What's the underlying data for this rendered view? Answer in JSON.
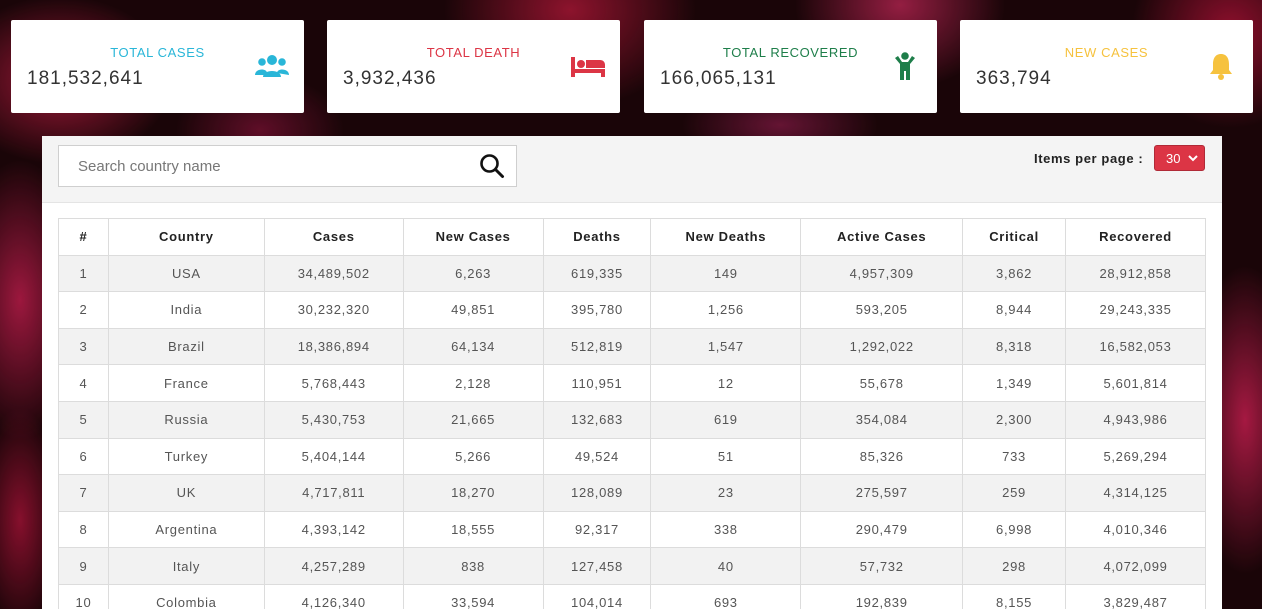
{
  "stats": [
    {
      "title": "TOTAL CASES",
      "value": "181,532,641",
      "color": "#29b6d8",
      "icon": "users-icon"
    },
    {
      "title": "TOTAL DEATH",
      "value": "3,932,436",
      "color": "#dc3545",
      "icon": "bed-icon"
    },
    {
      "title": "TOTAL RECOVERED",
      "value": "166,065,131",
      "color": "#1e7e4a",
      "icon": "person-icon"
    },
    {
      "title": "NEW CASES",
      "value": "363,794",
      "color": "#f6c23e",
      "icon": "bell-icon"
    }
  ],
  "search": {
    "placeholder": "Search country name",
    "value": ""
  },
  "pagination": {
    "label": "Items per page :",
    "selected": "30"
  },
  "table": {
    "headers": [
      "#",
      "Country",
      "Cases",
      "New Cases",
      "Deaths",
      "New Deaths",
      "Active Cases",
      "Critical",
      "Recovered"
    ],
    "rows": [
      [
        "1",
        "USA",
        "34,489,502",
        "6,263",
        "619,335",
        "149",
        "4,957,309",
        "3,862",
        "28,912,858"
      ],
      [
        "2",
        "India",
        "30,232,320",
        "49,851",
        "395,780",
        "1,256",
        "593,205",
        "8,944",
        "29,243,335"
      ],
      [
        "3",
        "Brazil",
        "18,386,894",
        "64,134",
        "512,819",
        "1,547",
        "1,292,022",
        "8,318",
        "16,582,053"
      ],
      [
        "4",
        "France",
        "5,768,443",
        "2,128",
        "110,951",
        "12",
        "55,678",
        "1,349",
        "5,601,814"
      ],
      [
        "5",
        "Russia",
        "5,430,753",
        "21,665",
        "132,683",
        "619",
        "354,084",
        "2,300",
        "4,943,986"
      ],
      [
        "6",
        "Turkey",
        "5,404,144",
        "5,266",
        "49,524",
        "51",
        "85,326",
        "733",
        "5,269,294"
      ],
      [
        "7",
        "UK",
        "4,717,811",
        "18,270",
        "128,089",
        "23",
        "275,597",
        "259",
        "4,314,125"
      ],
      [
        "8",
        "Argentina",
        "4,393,142",
        "18,555",
        "92,317",
        "338",
        "290,479",
        "6,998",
        "4,010,346"
      ],
      [
        "9",
        "Italy",
        "4,257,289",
        "838",
        "127,458",
        "40",
        "57,732",
        "298",
        "4,072,099"
      ],
      [
        "10",
        "Colombia",
        "4,126,340",
        "33,594",
        "104,014",
        "693",
        "192,839",
        "8,155",
        "3,829,487"
      ]
    ]
  },
  "colors": {
    "new_cases": "#f6a623",
    "new_deaths": "#dc3545",
    "select_bg": "#dc3545"
  }
}
